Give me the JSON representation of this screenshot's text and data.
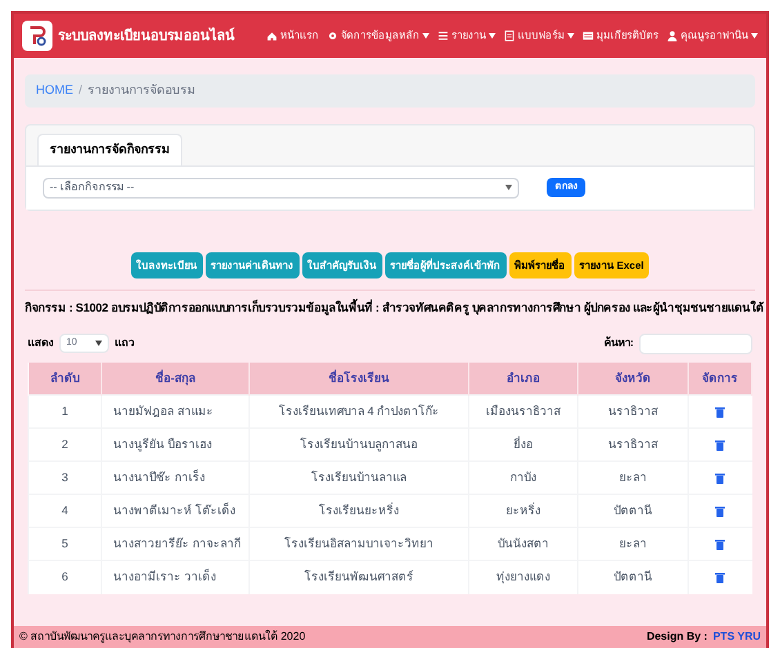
{
  "navbar": {
    "brand": "ระบบลงทะเบียนอบรมออนไลน์",
    "items": [
      {
        "label": "หน้าแรก",
        "dropdown": false
      },
      {
        "label": "จัดการข้อมูลหลัก",
        "dropdown": true
      },
      {
        "label": "รายงาน",
        "dropdown": true
      },
      {
        "label": "แบบฟอร์ม",
        "dropdown": true
      },
      {
        "label": "มุมเกียรติบัตร",
        "dropdown": false
      },
      {
        "label": "คุณนูรอาฟานิน",
        "dropdown": true
      }
    ]
  },
  "breadcrumb": [
    "HOME",
    "/",
    "รายงานการจัดอบรม"
  ],
  "card": {
    "tab": "รายงานการจัดกิจกรรม",
    "select": "-- เลือกกิจกรรม --",
    "button": "ตกลง"
  },
  "actions": [
    {
      "label": "ใบลงทะเบียน",
      "kind": "info"
    },
    {
      "label": "รายงานค่าเดินทาง",
      "kind": "info"
    },
    {
      "label": "ใบสำคัญรับเงิน",
      "kind": "info"
    },
    {
      "label": "รายชื่อผู้ที่ประสงค์เข้าพัก",
      "kind": "info"
    },
    {
      "label": "พิมพ์รายชื่อ",
      "kind": "warning"
    },
    {
      "label": "รายงาน Excel",
      "kind": "warning"
    }
  ],
  "activity": "กิจกรรม : S1002 อบรมปฏิบัติการออกแบบการเก็บรวบรวมข้อมูลในพื้นที่ : สำรวจทัศนคติครู บุคลากรทางการศึกษา ผู้ปกครอง และผู้นำชุมชนชายแดนใต้",
  "table_controls": {
    "show_label": "แสดง",
    "length": "10",
    "rows_label": "แถว",
    "search_label": "ค้นหา:"
  },
  "table": {
    "columns": [
      "ลำดับ",
      "ชื่อ-สกุล",
      "ชื่อโรงเรียน",
      "อำเภอ",
      "จังหวัด",
      "จัดการ"
    ],
    "rows": [
      [
        "1",
        "นายมัฟฎอล สาแมะ",
        "โรงเรียนเทศบาล 4 กำปงตาโก๊ะ",
        "เมืองนราธิวาส",
        "นราธิวาส"
      ],
      [
        "2",
        "นางนูรียัน บือราเฮง",
        "โรงเรียนบ้านบลูกาสนอ",
        "ยี่งอ",
        "นราธิวาส"
      ],
      [
        "3",
        "นางนาปีซ๊ะ กาเร็ง",
        "โรงเรียนบ้านลาแล",
        "กาบัง",
        "ยะลา"
      ],
      [
        "4",
        "นางพาตีเมาะห์ โต๊ะเด็ง",
        "โรงเรียนยะหริ่ง",
        "ยะหริ่ง",
        "ปัตตานี"
      ],
      [
        "5",
        "นางสาวยารีย๊ะ กาจะลากี",
        "โรงเรียนอิสลามบาเจาะวิทยา",
        "บันนังสตา",
        "ยะลา"
      ],
      [
        "6",
        "นางอามีเราะ วาเด็ง",
        "โรงเรียนพัฒนศาสตร์",
        "ทุ่งยางแดง",
        "ปัตตานี"
      ]
    ]
  },
  "footer": {
    "copyright": "© สถาบันพัฒนาครูและบุคลากรทางการศึกษาชายแดนใต้ 2020",
    "design_label": "Design By :",
    "design_link": "PTS YRU"
  }
}
